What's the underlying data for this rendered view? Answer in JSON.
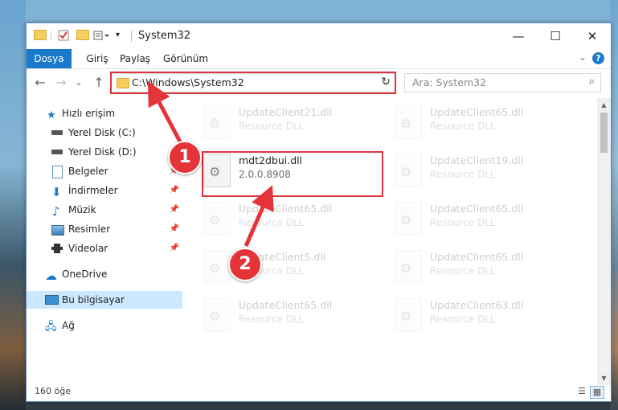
{
  "window": {
    "title": "System32",
    "controls": {
      "minimize": "—",
      "maximize": "☐",
      "close": "✕"
    }
  },
  "ribbon": {
    "tabs": [
      "Dosya",
      "Giriş",
      "Paylaş",
      "Görünüm"
    ],
    "help": "?",
    "expand": "⌄"
  },
  "nav": {
    "back": "←",
    "forward": "→",
    "recent": "⌄",
    "up": "↑",
    "address_path": "C:\\Windows\\System32",
    "address_dropdown": "⌄",
    "refresh": "↻",
    "search_placeholder": "Ara: System32",
    "search_icon": "⌕"
  },
  "sidebar": {
    "items": [
      {
        "label": "Hızlı erişim",
        "icon": "star-icon"
      },
      {
        "label": "Yerel Disk (C:)",
        "icon": "drive-icon"
      },
      {
        "label": "Yerel Disk (D:)",
        "icon": "drive-icon"
      },
      {
        "label": "Belgeler",
        "icon": "document-icon",
        "pinned": true
      },
      {
        "label": "İndirmeler",
        "icon": "download-icon",
        "pinned": true
      },
      {
        "label": "Müzik",
        "icon": "music-icon",
        "pinned": true
      },
      {
        "label": "Resimler",
        "icon": "pictures-icon",
        "pinned": true
      },
      {
        "label": "Videolar",
        "icon": "video-icon",
        "pinned": true
      },
      {
        "label": "OneDrive",
        "icon": "cloud-icon"
      },
      {
        "label": "Bu bilgisayar",
        "icon": "computer-icon",
        "selected": true
      },
      {
        "label": "Ağ",
        "icon": "network-icon"
      }
    ],
    "pin_glyph": "📌"
  },
  "files": {
    "left": [
      {
        "name": "UpdateClient21.dll",
        "sub": "Resource DLL"
      },
      {
        "name": "mdt2dbui.dll",
        "sub": "2.0.0.8908"
      },
      {
        "name": "UpdateClient65.dll",
        "sub": "Resource DLL"
      },
      {
        "name": "UpdateClient5.dll",
        "sub": "Resource DLL"
      },
      {
        "name": "UpdateClient65.dll",
        "sub": "Resource DLL"
      }
    ],
    "right": [
      {
        "name": "UpdateClient65.dll",
        "sub": "Resource DLL"
      },
      {
        "name": "UpdateClient19.dll",
        "sub": "Resource DLL"
      },
      {
        "name": "UpdateClient65.dll",
        "sub": "Resource DLL"
      },
      {
        "name": "UpdateClient65.dll",
        "sub": "Resource DLL"
      },
      {
        "name": "UpdateClient63.dll",
        "sub": "Resource DLL"
      }
    ]
  },
  "status": {
    "count": "160 öğe"
  },
  "annotations": {
    "badge1": "1",
    "badge2": "2",
    "color": "#e5333a"
  }
}
